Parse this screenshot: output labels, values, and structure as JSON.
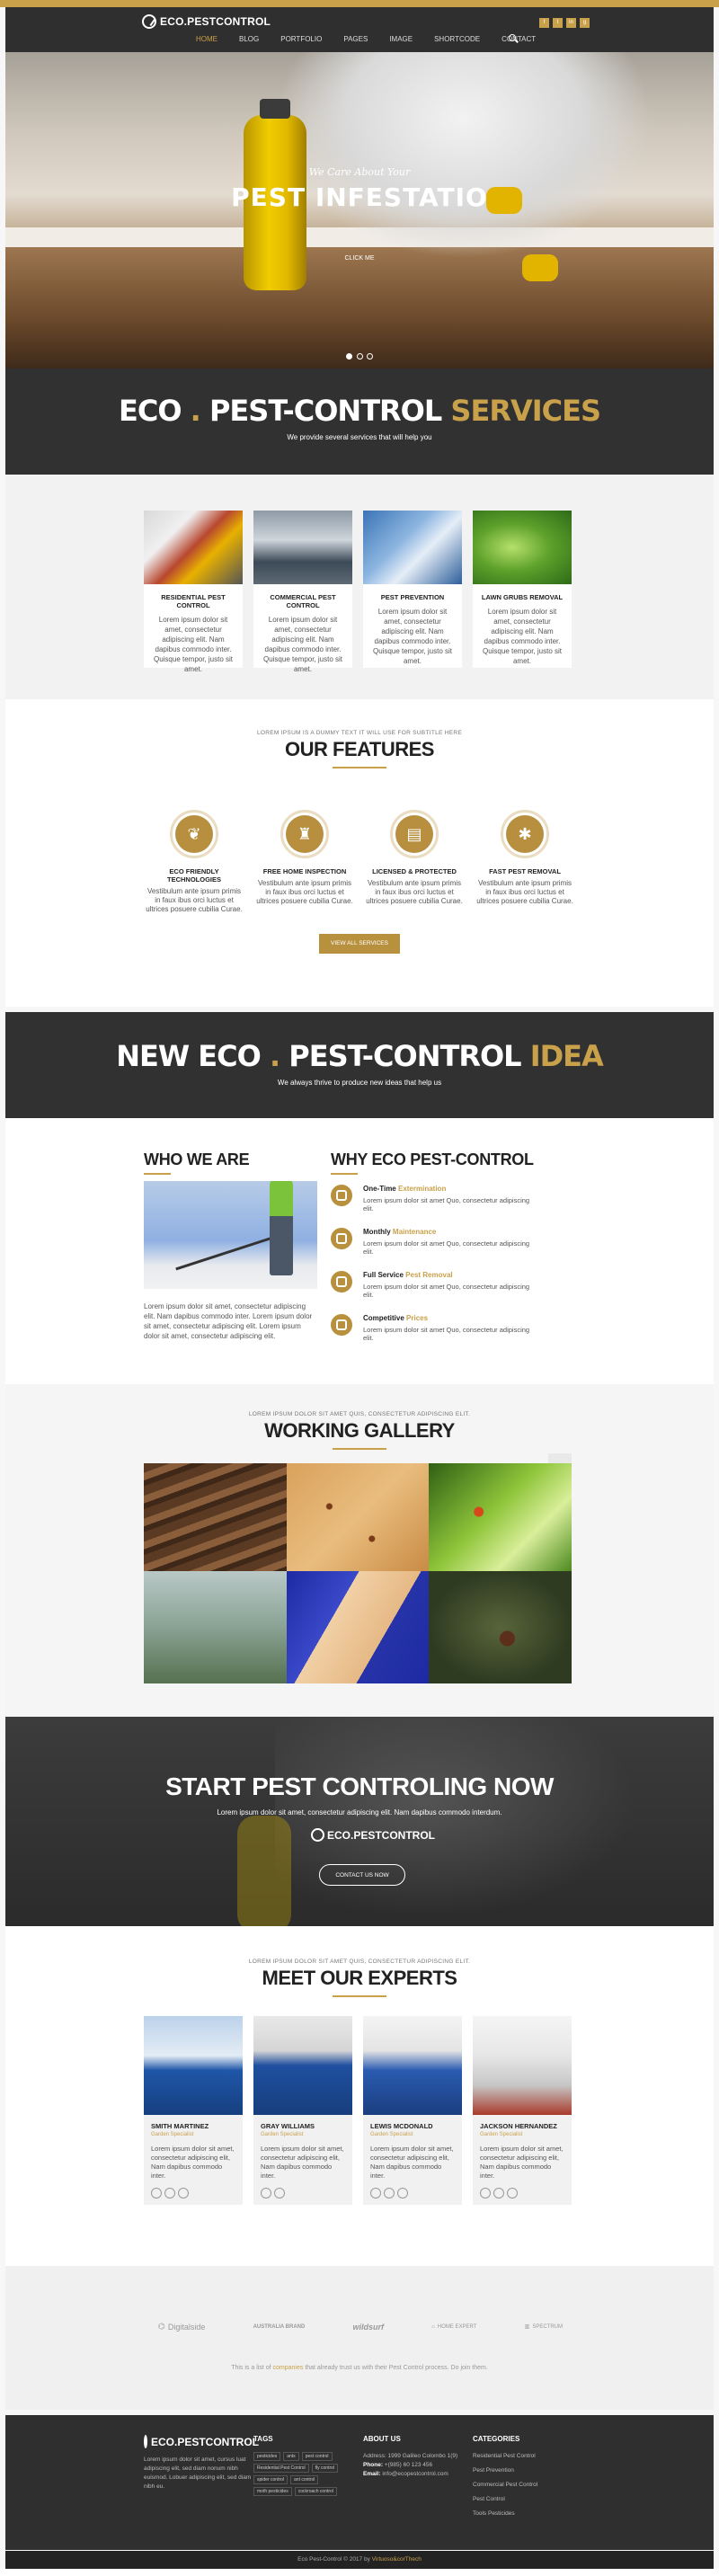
{
  "brand": {
    "name": "ECO.PESTCONTROL",
    "accent": "#c9a14a",
    "dark": "#313131"
  },
  "nav": [
    "HOME",
    "BLOG",
    "PORTFOLIO",
    "PAGES",
    "IMAGE",
    "SHORTCODE",
    "CONTACT"
  ],
  "social": [
    "f",
    "t",
    "in",
    "g"
  ],
  "hero": {
    "subtitle": "We Care About Your",
    "title": "PEST INFESTATIO",
    "small": "CLICK ME",
    "slides": 3,
    "active_slide": 0
  },
  "services_band": {
    "title_white": "ECO",
    "title_dot": ".",
    "title_mid": "PEST-CONTROL",
    "title_gold": "SERVICES",
    "subtitle": "We provide several services that will help you"
  },
  "services": [
    {
      "title": "RESIDENTIAL PEST CONTROL",
      "text": "Lorem ipsum dolor sit amet, consectetur adipiscing elit. Nam dapibus commodo inter. Quisque tempor, justo sit amet."
    },
    {
      "title": "COMMERCIAL PEST CONTROL",
      "text": "Lorem ipsum dolor sit amet, consectetur adipiscing elit. Nam dapibus commodo inter. Quisque tempor, justo sit amet."
    },
    {
      "title": "PEST PREVENTION",
      "text": "Lorem ipsum dolor sit amet, consectetur adipiscing elit. Nam dapibus commodo inter. Quisque tempor, justo sit amet."
    },
    {
      "title": "LAWN GRUBS REMOVAL",
      "text": "Lorem ipsum dolor sit amet, consectetur adipiscing elit. Nam dapibus commodo inter. Quisque tempor, justo sit amet."
    }
  ],
  "features": {
    "eyebrow": "LOREM IPSUM IS A DUMMY TEXT IT WILL USE FOR SUBTITLE HERE",
    "title": "OUR FEATURES",
    "items": [
      {
        "title": "ECO FRIENDLY TECHNOLOGIES",
        "text": "Vestibulum ante ipsum primis in faux ibus orci luctus et ultrices posuere cubilia Curae."
      },
      {
        "title": "FREE HOME INSPECTION",
        "text": "Vestibulum ante ipsum primis in faux ibus orci luctus et ultrices posuere cubilia Curae."
      },
      {
        "title": "LICENSED & PROTECTED",
        "text": "Vestibulum ante ipsum primis in faux ibus orci luctus et ultrices posuere cubilia Curae."
      },
      {
        "title": "FAST PEST REMOVAL",
        "text": "Vestibulum ante ipsum primis in faux ibus orci luctus et ultrices posuere cubilia Curae."
      }
    ],
    "button": "VIEW ALL SERVICES"
  },
  "idea_band": {
    "title_white": "NEW ECO",
    "title_dot": ".",
    "title_mid": "PEST-CONTROL",
    "title_gold": "IDEA",
    "subtitle": "We always thrive to produce new ideas that help us"
  },
  "about": {
    "left_title": "WHO WE ARE",
    "left_text": "Lorem ipsum dolor sit amet, consectetur adipiscing elit. Nam dapibus commodo inter. Lorem ipsum dolor sit amet, consectetur adipiscing elit. Lorem ipsum dolor sit amet, consectetur adipiscing elit.",
    "right_title": "WHY ECO PEST-CONTROL",
    "items": [
      {
        "title": "One-Time",
        "gold": "Extermination",
        "text": "Lorem ipsum dolor sit amet Quo, consectetur adipiscing elit."
      },
      {
        "title": "Monthly",
        "gold": "Maintenance",
        "text": "Lorem ipsum dolor sit amet Quo, consectetur adipiscing elit."
      },
      {
        "title": "Full Service",
        "gold": "Pest Removal",
        "text": "Lorem ipsum dolor sit amet Quo, consectetur adipiscing elit."
      },
      {
        "title": "Competitive",
        "gold": "Prices",
        "text": "Lorem ipsum dolor sit amet Quo, consectetur adipiscing elit."
      }
    ]
  },
  "gallery": {
    "eyebrow": "LOREM IPSUM DOLOR SIT AMET QUIS, CONSECTETUR ADIPISCING ELIT.",
    "title": "WORKING GALLERY"
  },
  "cta": {
    "title": "START PEST CONTROLING NOW",
    "text": "Lorem ipsum dolor sit amet, consectetur adipiscing elit. Nam dapibus commodo interdum.",
    "logo": "ECO.PESTCONTROL",
    "button": "CONTACT US NOW"
  },
  "team": {
    "eyebrow": "LOREM IPSUM DOLOR SIT AMET QUIS, CONSECTETUR ADIPISCING ELIT.",
    "title": "MEET OUR EXPERTS",
    "members": [
      {
        "name": "SMITH MARTINEZ",
        "role": "Garden Specialist",
        "text": "Lorem ipsum dolor sit amet, consectetur adipiscing elit, Nam dapibus commodo inter."
      },
      {
        "name": "GRAY WILLIAMS",
        "role": "Garden Specialist",
        "text": "Lorem ipsum dolor sit amet, consectetur adipiscing elit, Nam dapibus commodo inter."
      },
      {
        "name": "LEWIS MCDONALD",
        "role": "Garden Specialist",
        "text": "Lorem ipsum dolor sit amet, consectetur adipiscing elit, Nam dapibus commodo inter."
      },
      {
        "name": "JACKSON HERNANDEZ",
        "role": "Garden Specialist",
        "text": "Lorem ipsum dolor sit amet, consectetur adipiscing elit, Nam dapibus commodo inter."
      }
    ]
  },
  "clients": {
    "logos": [
      "Digitalside",
      "AUSTRALIA BRAND",
      "wildsurf",
      "HOME EXPERT",
      "SPECTRUM"
    ],
    "note_pre": "This is a list of",
    "note_gold": "companies",
    "note_post": "that already trust us with their Pest Control process. Do join them."
  },
  "footer": {
    "about_text": "Lorem ipsum dolor sit amet, cursus luat adipiscing elit, sed diam nonum nibh euismod. Lobuer adipiscing elit, sed diam nibh eu.",
    "tags_title": "TAGS",
    "tags": [
      "pesticides",
      "ants",
      "pest control",
      "Residential Pest Control",
      "fly control",
      "spider control",
      "ant control",
      "moth pesticides",
      "cockroach control"
    ],
    "contact_title": "ABOUT US",
    "address": "Address: 1999 Galileo Colombo 1(9)",
    "phone_label": "Phone:",
    "phone": "+(985) 60 123 456",
    "email_label": "Email:",
    "email": "info@ecopestcontrol.com",
    "cat_title": "CATEGORIES",
    "categories": [
      "Residential Pest Control",
      "Pest Prevention",
      "Commercial Pest Control",
      "Pest Control",
      "Tools Pesticides"
    ],
    "copy_pre": "Eco Pest-Control © 2017 by",
    "copy_gold": "Virtuoso&corThech"
  }
}
